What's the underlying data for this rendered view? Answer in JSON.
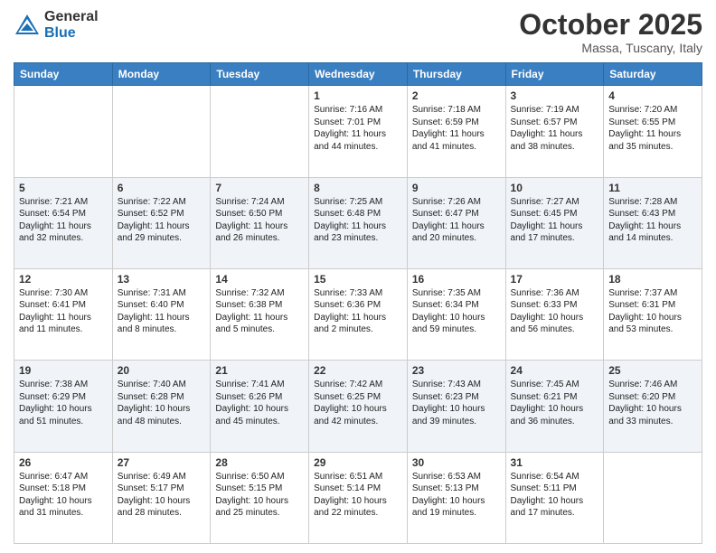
{
  "header": {
    "logo_general": "General",
    "logo_blue": "Blue",
    "month_title": "October 2025",
    "subtitle": "Massa, Tuscany, Italy"
  },
  "weekdays": [
    "Sunday",
    "Monday",
    "Tuesday",
    "Wednesday",
    "Thursday",
    "Friday",
    "Saturday"
  ],
  "weeks": [
    [
      {
        "day": "",
        "info": ""
      },
      {
        "day": "",
        "info": ""
      },
      {
        "day": "",
        "info": ""
      },
      {
        "day": "1",
        "info": "Sunrise: 7:16 AM\nSunset: 7:01 PM\nDaylight: 11 hours and 44 minutes."
      },
      {
        "day": "2",
        "info": "Sunrise: 7:18 AM\nSunset: 6:59 PM\nDaylight: 11 hours and 41 minutes."
      },
      {
        "day": "3",
        "info": "Sunrise: 7:19 AM\nSunset: 6:57 PM\nDaylight: 11 hours and 38 minutes."
      },
      {
        "day": "4",
        "info": "Sunrise: 7:20 AM\nSunset: 6:55 PM\nDaylight: 11 hours and 35 minutes."
      }
    ],
    [
      {
        "day": "5",
        "info": "Sunrise: 7:21 AM\nSunset: 6:54 PM\nDaylight: 11 hours and 32 minutes."
      },
      {
        "day": "6",
        "info": "Sunrise: 7:22 AM\nSunset: 6:52 PM\nDaylight: 11 hours and 29 minutes."
      },
      {
        "day": "7",
        "info": "Sunrise: 7:24 AM\nSunset: 6:50 PM\nDaylight: 11 hours and 26 minutes."
      },
      {
        "day": "8",
        "info": "Sunrise: 7:25 AM\nSunset: 6:48 PM\nDaylight: 11 hours and 23 minutes."
      },
      {
        "day": "9",
        "info": "Sunrise: 7:26 AM\nSunset: 6:47 PM\nDaylight: 11 hours and 20 minutes."
      },
      {
        "day": "10",
        "info": "Sunrise: 7:27 AM\nSunset: 6:45 PM\nDaylight: 11 hours and 17 minutes."
      },
      {
        "day": "11",
        "info": "Sunrise: 7:28 AM\nSunset: 6:43 PM\nDaylight: 11 hours and 14 minutes."
      }
    ],
    [
      {
        "day": "12",
        "info": "Sunrise: 7:30 AM\nSunset: 6:41 PM\nDaylight: 11 hours and 11 minutes."
      },
      {
        "day": "13",
        "info": "Sunrise: 7:31 AM\nSunset: 6:40 PM\nDaylight: 11 hours and 8 minutes."
      },
      {
        "day": "14",
        "info": "Sunrise: 7:32 AM\nSunset: 6:38 PM\nDaylight: 11 hours and 5 minutes."
      },
      {
        "day": "15",
        "info": "Sunrise: 7:33 AM\nSunset: 6:36 PM\nDaylight: 11 hours and 2 minutes."
      },
      {
        "day": "16",
        "info": "Sunrise: 7:35 AM\nSunset: 6:34 PM\nDaylight: 10 hours and 59 minutes."
      },
      {
        "day": "17",
        "info": "Sunrise: 7:36 AM\nSunset: 6:33 PM\nDaylight: 10 hours and 56 minutes."
      },
      {
        "day": "18",
        "info": "Sunrise: 7:37 AM\nSunset: 6:31 PM\nDaylight: 10 hours and 53 minutes."
      }
    ],
    [
      {
        "day": "19",
        "info": "Sunrise: 7:38 AM\nSunset: 6:29 PM\nDaylight: 10 hours and 51 minutes."
      },
      {
        "day": "20",
        "info": "Sunrise: 7:40 AM\nSunset: 6:28 PM\nDaylight: 10 hours and 48 minutes."
      },
      {
        "day": "21",
        "info": "Sunrise: 7:41 AM\nSunset: 6:26 PM\nDaylight: 10 hours and 45 minutes."
      },
      {
        "day": "22",
        "info": "Sunrise: 7:42 AM\nSunset: 6:25 PM\nDaylight: 10 hours and 42 minutes."
      },
      {
        "day": "23",
        "info": "Sunrise: 7:43 AM\nSunset: 6:23 PM\nDaylight: 10 hours and 39 minutes."
      },
      {
        "day": "24",
        "info": "Sunrise: 7:45 AM\nSunset: 6:21 PM\nDaylight: 10 hours and 36 minutes."
      },
      {
        "day": "25",
        "info": "Sunrise: 7:46 AM\nSunset: 6:20 PM\nDaylight: 10 hours and 33 minutes."
      }
    ],
    [
      {
        "day": "26",
        "info": "Sunrise: 6:47 AM\nSunset: 5:18 PM\nDaylight: 10 hours and 31 minutes."
      },
      {
        "day": "27",
        "info": "Sunrise: 6:49 AM\nSunset: 5:17 PM\nDaylight: 10 hours and 28 minutes."
      },
      {
        "day": "28",
        "info": "Sunrise: 6:50 AM\nSunset: 5:15 PM\nDaylight: 10 hours and 25 minutes."
      },
      {
        "day": "29",
        "info": "Sunrise: 6:51 AM\nSunset: 5:14 PM\nDaylight: 10 hours and 22 minutes."
      },
      {
        "day": "30",
        "info": "Sunrise: 6:53 AM\nSunset: 5:13 PM\nDaylight: 10 hours and 19 minutes."
      },
      {
        "day": "31",
        "info": "Sunrise: 6:54 AM\nSunset: 5:11 PM\nDaylight: 10 hours and 17 minutes."
      },
      {
        "day": "",
        "info": ""
      }
    ]
  ]
}
